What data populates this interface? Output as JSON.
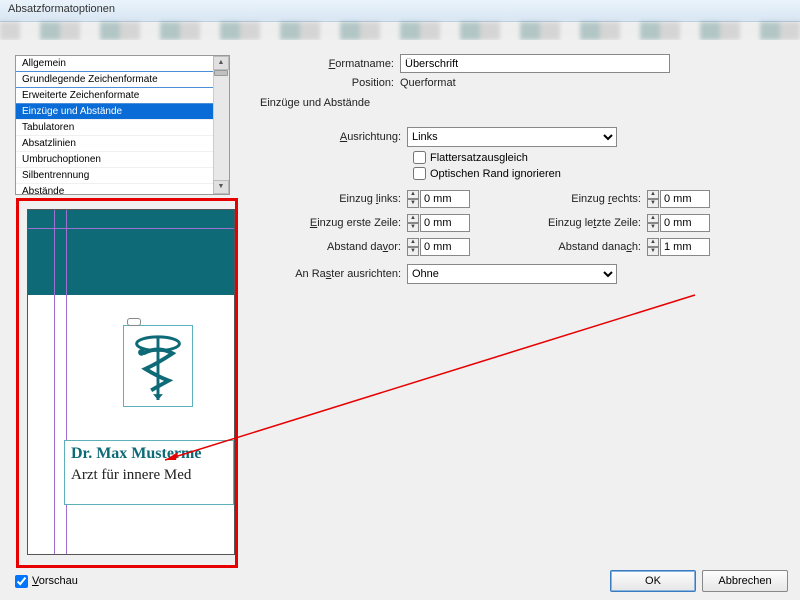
{
  "window": {
    "title": "Absatzformatoptionen"
  },
  "sidebar": {
    "items": [
      {
        "label": "Allgemein"
      },
      {
        "label": "Grundlegende Zeichenformate"
      },
      {
        "label": "Erweiterte Zeichenformate"
      },
      {
        "label": "Einzüge und Abstände"
      },
      {
        "label": "Tabulatoren"
      },
      {
        "label": "Absatzlinien"
      },
      {
        "label": "Umbruchoptionen"
      },
      {
        "label": "Silbentrennung"
      },
      {
        "label": "Abstände"
      }
    ],
    "selected_index": 3
  },
  "header": {
    "formatname_label": "Formatname:",
    "formatname_value": "Überschrift",
    "position_label": "Position:",
    "position_value": "Querformat",
    "section_title": "Einzüge und Abstände"
  },
  "form": {
    "ausrichtung_label": "Ausrichtung:",
    "ausrichtung_value": "Links",
    "flattersatz_label": "Flattersatzausgleich",
    "optischer_rand_label": "Optischen Rand ignorieren",
    "einzug_links_label": "Einzug links:",
    "einzug_links_value": "0 mm",
    "einzug_rechts_label": "Einzug rechts:",
    "einzug_rechts_value": "0 mm",
    "einzug_erste_label": "Einzug erste Zeile:",
    "einzug_erste_value": "0 mm",
    "einzug_letzte_label": "Einzug letzte Zeile:",
    "einzug_letzte_value": "0 mm",
    "abstand_davor_label": "Abstand davor:",
    "abstand_davor_value": "0 mm",
    "abstand_danach_label": "Abstand danach:",
    "abstand_danach_value": "1 mm",
    "raster_label": "An Raster ausrichten:",
    "raster_value": "Ohne"
  },
  "preview": {
    "name_line1": "Dr. Max Musterme",
    "name_line2": "Arzt für innere Med"
  },
  "footer": {
    "vorschau_label": "Vorschau",
    "ok_label": "OK",
    "cancel_label": "Abbrechen"
  }
}
